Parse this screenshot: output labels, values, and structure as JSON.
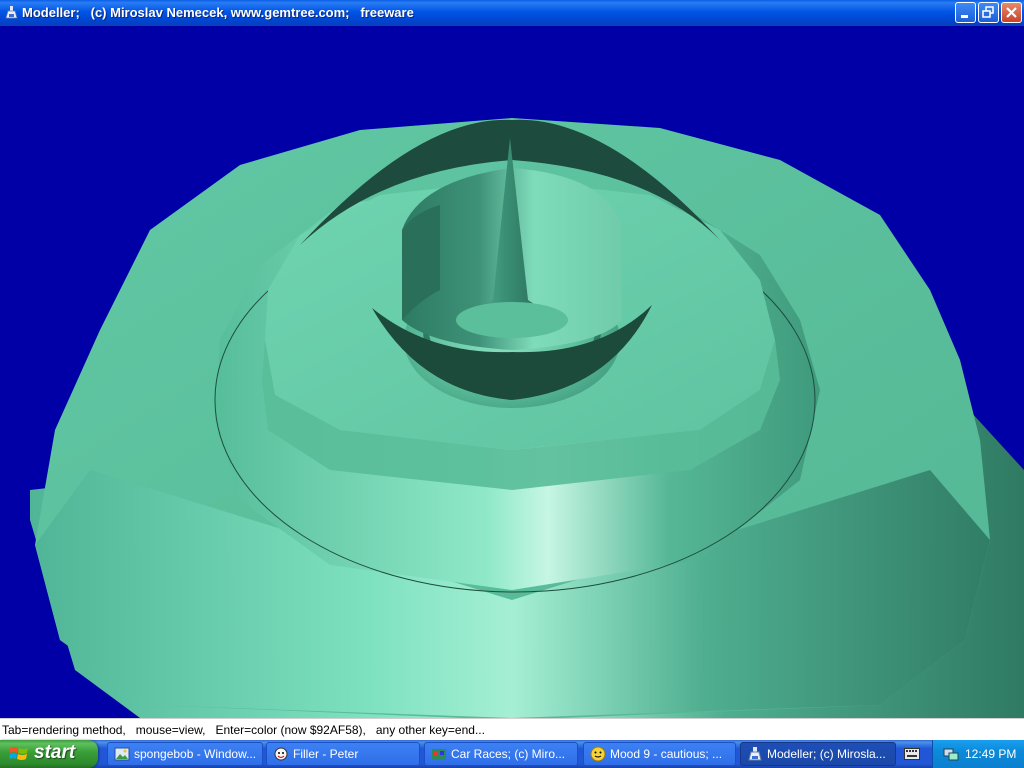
{
  "window": {
    "title": "Modeller;   (c) Miroslav Nemecek, www.gemtree.com;   freeware",
    "background_color": "#0000a6",
    "model_color": "#5fcfa8"
  },
  "status": {
    "text": "Tab=rendering method,   mouse=view,   Enter=color (now $92AF58),   any other key=end..."
  },
  "taskbar": {
    "start_label": "start",
    "tasks": [
      {
        "label": "spongebob - Window...",
        "icon": "image-icon"
      },
      {
        "label": "Filler - Peter",
        "icon": "cartoon-icon"
      },
      {
        "label": "Car Races;  (c) Miro...",
        "icon": "app-icon"
      },
      {
        "label": "Mood 9 - cautious;  ...",
        "icon": "smiley-icon"
      },
      {
        "label": "Modeller;  (c) Mirosla...",
        "icon": "flask-icon",
        "active": true
      }
    ],
    "clock": "12:49 PM"
  }
}
